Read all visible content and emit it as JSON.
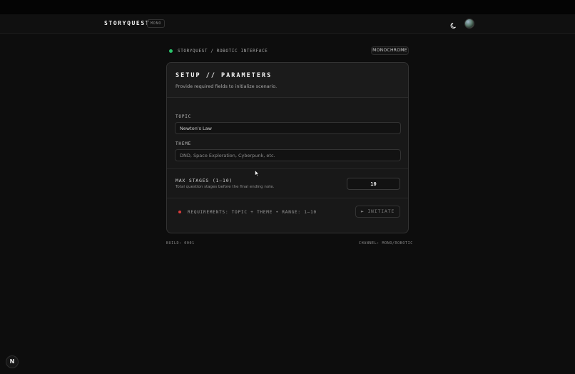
{
  "navbar": {
    "brand": "STORYQUEST",
    "badge": "MONO",
    "theme_icon": "moon-icon",
    "avatar_icon": "user-avatar"
  },
  "breadcrumb": {
    "text": "STORYQUEST / ROBOTIC INTERFACE",
    "status_color": "#2bc46b",
    "mode_badge": "MONOCHROME"
  },
  "card": {
    "title": "SETUP // PARAMETERS",
    "subtitle": "Provide required fields to initialize scenario.",
    "topic": {
      "label": "TOPIC",
      "value": "Newton's Law",
      "placeholder": ""
    },
    "theme": {
      "label": "THEME",
      "value": "",
      "placeholder": "DND, Space Exploration, Cyberpunk, etc."
    },
    "max_stages": {
      "label": "MAX STAGES (1–10)",
      "help": "Total question stages before the final ending note.",
      "value": "10"
    },
    "requirements": {
      "text": "REQUIREMENTS: TOPIC + THEME • RANGE: 1–10",
      "status_color": "#d93b3b"
    },
    "initiate_label": "► INITIATE"
  },
  "footer": {
    "build": "BUILD: 0001",
    "channel": "CHANNEL: MONO/ROBOTIC"
  },
  "dev_badge": "N"
}
